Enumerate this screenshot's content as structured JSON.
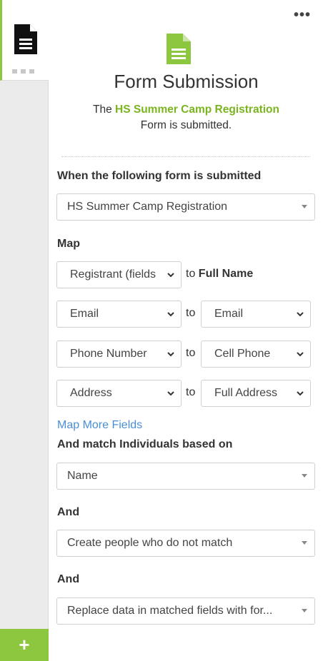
{
  "rail": {
    "add_label": "+"
  },
  "header": {
    "more_label": "•••",
    "title": "Form Submission",
    "subtitle_prefix": "The ",
    "subtitle_form": "HS Summer Camp Registration",
    "subtitle_suffix": "Form is submitted."
  },
  "form_section": {
    "label": "When the following form is submitted",
    "selected": "HS Summer Camp Registration"
  },
  "map": {
    "label": "Map",
    "rows": [
      {
        "source": "Registrant (fields",
        "to": "to",
        "target": "Full Name"
      },
      {
        "source": "Email",
        "to": "to",
        "target": "Email"
      },
      {
        "source": "Phone Number",
        "to": "to",
        "target": "Cell Phone"
      },
      {
        "source": "Address",
        "to": "to",
        "target": "Full Address"
      }
    ],
    "more_link": "Map More Fields"
  },
  "match": {
    "label": "And match Individuals based on",
    "selected": "Name"
  },
  "and1": {
    "label": "And",
    "selected": "Create people who do not match"
  },
  "and2": {
    "label": "And",
    "selected": "Replace data in matched fields with for..."
  },
  "colors": {
    "accent": "#8dc63f",
    "link": "#4a8fd6"
  }
}
